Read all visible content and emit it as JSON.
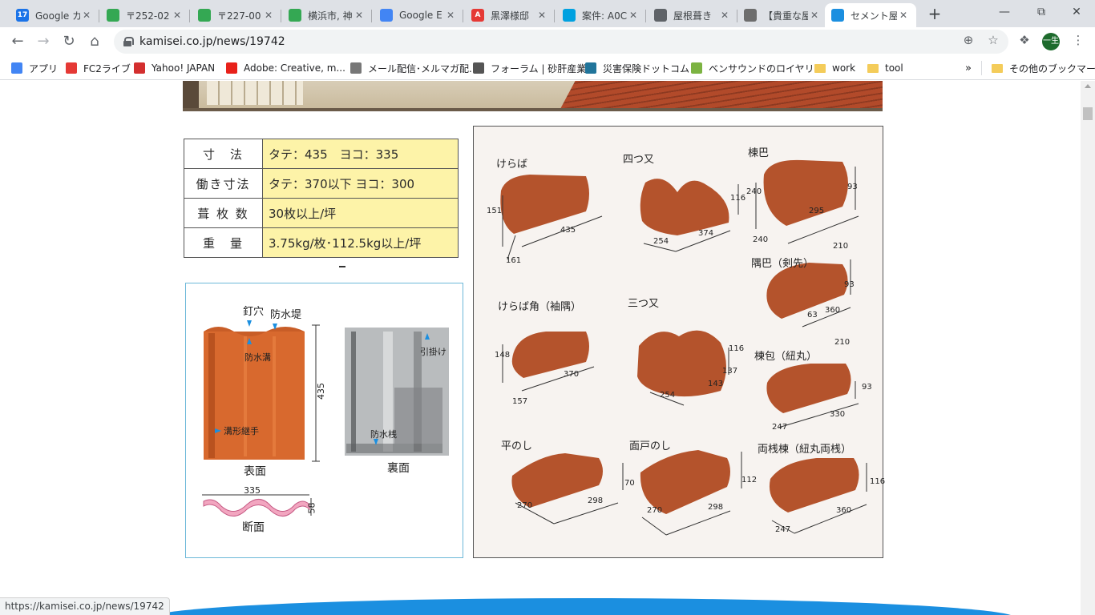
{
  "browser": {
    "tabs": [
      {
        "title": "Google カ",
        "icon": "calendar-icon",
        "color": "#1a73e8",
        "glyph": "17"
      },
      {
        "title": "〒252-02",
        "icon": "maps-pin-icon",
        "color": "#34a853",
        "glyph": ""
      },
      {
        "title": "〒227-00",
        "icon": "maps-pin-icon",
        "color": "#34a853",
        "glyph": ""
      },
      {
        "title": "横浜市, 神",
        "icon": "maps-pin-icon",
        "color": "#34a853",
        "glyph": ""
      },
      {
        "title": "Google E",
        "icon": "earth-icon",
        "color": "#4285f4",
        "glyph": ""
      },
      {
        "title": "黒澤様邸",
        "icon": "app-icon",
        "color": "#e53935",
        "glyph": "A"
      },
      {
        "title": "案件: A0C",
        "icon": "cloud-icon",
        "color": "#00a1e0",
        "glyph": ""
      },
      {
        "title": "屋根葺き",
        "icon": "globe-icon",
        "color": "#5f6368",
        "glyph": ""
      },
      {
        "title": "【貴重な屋",
        "icon": "site-icon",
        "color": "#6d6d6d",
        "glyph": ""
      },
      {
        "title": "セメント屋",
        "icon": "kamisei-icon",
        "color": "#1b8fe0",
        "glyph": ""
      }
    ],
    "url": "kamisei.co.jp/news/19742",
    "profile_initial": "一生",
    "bookmarks": [
      {
        "label": "アプリ",
        "type": "apps"
      },
      {
        "label": "FC2ライブ",
        "type": "site"
      },
      {
        "label": "Yahoo! JAPAN",
        "type": "site"
      },
      {
        "label": "Adobe: Creative, m...",
        "type": "site"
      },
      {
        "label": "メール配信･メルマガ配...",
        "type": "site"
      },
      {
        "label": "フォーラム | 砂肝産業",
        "type": "site"
      },
      {
        "label": "災害保険ドットコム",
        "type": "site"
      },
      {
        "label": "ベンサウンドのロイヤリ...",
        "type": "site"
      },
      {
        "label": "work",
        "type": "folder"
      },
      {
        "label": "tool",
        "type": "folder"
      }
    ],
    "bookmarks_overflow": "»",
    "other_bookmarks": "その他のブックマーク",
    "status_url": "https://kamisei.co.jp/news/19742"
  },
  "spec_table": [
    {
      "key": "寸　法",
      "value": "タテ：435　ヨコ：335"
    },
    {
      "key": "働き寸法",
      "value": "タテ：370以下 ヨコ：300"
    },
    {
      "key": "葺 枚 数",
      "value": "30枚以上/坪"
    },
    {
      "key": "重　量",
      "value": "3.75kg/枚･112.5kg以上/坪"
    }
  ],
  "tile_diagram": {
    "nail_hole": "釘穴",
    "waterproof_dam": "防水堤",
    "waterproof_groove": "防水溝",
    "groove_joint": "溝形継手",
    "length": "435",
    "front": "表面",
    "hook": "引掛け",
    "back_waterproof": "防水桟",
    "back": "裏面",
    "width": "335",
    "height": "58",
    "section": "断面"
  },
  "catalog": [
    {
      "name": "けらば",
      "dims": [
        "151",
        "435",
        "161"
      ]
    },
    {
      "name": "四つ又",
      "dims": [
        "116",
        "374",
        "254"
      ]
    },
    {
      "name": "棟巴",
      "dims": [
        "240",
        "93",
        "295",
        "240"
      ]
    },
    {
      "name": "隅巴（剣先）",
      "dims": [
        "210",
        "93",
        "360",
        "63"
      ]
    },
    {
      "name": "けらば角（袖隅）",
      "dims": [
        "148",
        "370",
        "157"
      ]
    },
    {
      "name": "三つ又",
      "dims": [
        "116",
        "254",
        "143",
        "137"
      ]
    },
    {
      "name": "棟包（紐丸）",
      "dims": [
        "210",
        "93",
        "330",
        "247"
      ]
    },
    {
      "name": "平のし",
      "dims": [
        "270",
        "298"
      ]
    },
    {
      "name": "面戸のし",
      "dims": [
        "112",
        "270",
        "298"
      ]
    },
    {
      "name": "両桟棟（紐丸両桟）",
      "dims": [
        "116",
        "360",
        "247"
      ]
    },
    {
      "name": "",
      "dims": [
        "70"
      ]
    }
  ],
  "colors": {
    "tile_orange": "#d8692e",
    "tile_terracotta": "#b4532c",
    "spec_highlight": "#fdf3a8",
    "banner_blue": "#1b8fe0"
  }
}
